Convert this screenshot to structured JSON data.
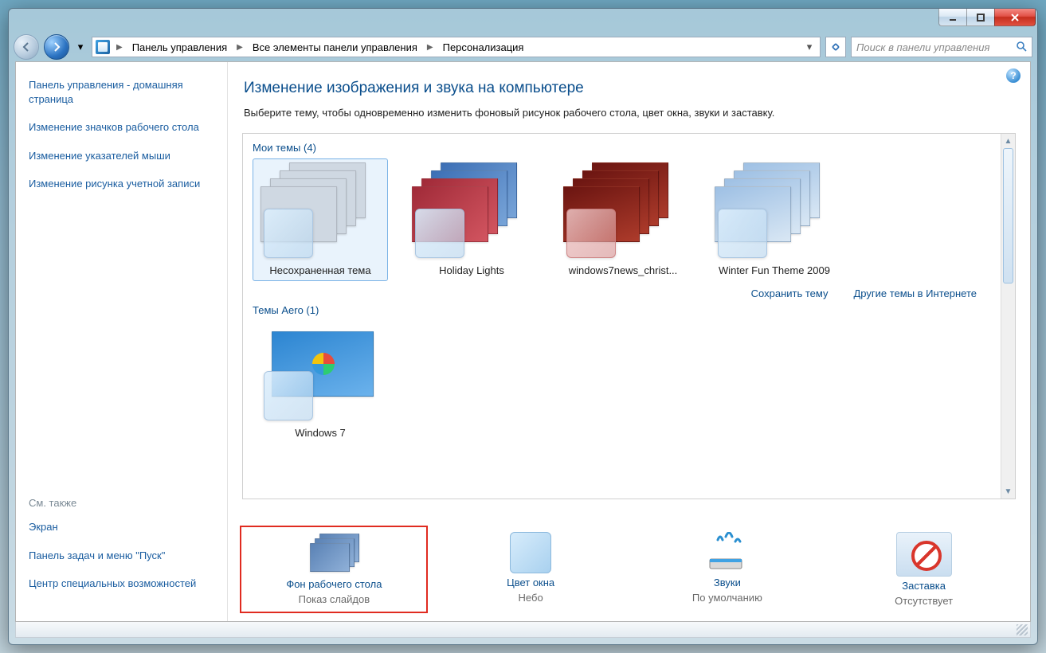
{
  "breadcrumbs": [
    "Панель управления",
    "Все элементы панели управления",
    "Персонализация"
  ],
  "search_placeholder": "Поиск в панели управления",
  "sidebar": {
    "home": "Панель управления - домашняя страница",
    "links": [
      "Изменение значков рабочего стола",
      "Изменение указателей мыши",
      "Изменение рисунка учетной записи"
    ],
    "see_also_heading": "См. также",
    "see_also": [
      "Экран",
      "Панель задач и меню \"Пуск\"",
      "Центр специальных возможностей"
    ]
  },
  "main": {
    "title": "Изменение изображения и звука на компьютере",
    "subtitle": "Выберите тему, чтобы одновременно изменить фоновый рисунок рабочего стола, цвет окна, звуки и заставку.",
    "groups": {
      "my": "Мои темы (4)",
      "aero": "Темы Aero (1)"
    },
    "themes_my": [
      "Несохраненная тема",
      "Holiday Lights",
      "windows7news_christ...",
      "Winter Fun Theme 2009"
    ],
    "themes_aero": [
      "Windows 7"
    ],
    "action_links": {
      "save": "Сохранить тему",
      "more": "Другие темы в Интернете"
    },
    "settings": {
      "bg": {
        "link": "Фон рабочего стола",
        "value": "Показ слайдов"
      },
      "color": {
        "link": "Цвет окна",
        "value": "Небо"
      },
      "sound": {
        "link": "Звуки",
        "value": "По умолчанию"
      },
      "saver": {
        "link": "Заставка",
        "value": "Отсутствует"
      }
    }
  }
}
